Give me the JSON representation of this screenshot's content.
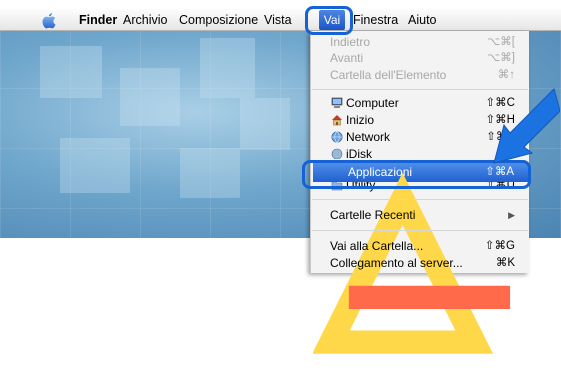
{
  "menubar": {
    "apple_icon": "apple-logo-icon",
    "items": [
      "Finder",
      "Archivio",
      "Composizione",
      "Vista",
      "Vai",
      "Finestra",
      "Aiuto"
    ]
  },
  "menu": {
    "items": [
      {
        "label": "Indietro",
        "shortcut": "⌥⌘[",
        "enabled": false
      },
      {
        "label": "Avanti",
        "shortcut": "⌥⌘]",
        "enabled": false
      },
      {
        "label": "Cartella dell'Elemento",
        "shortcut": "⌘↑",
        "enabled": false
      },
      {
        "label": "Computer",
        "shortcut": "⇧⌘C",
        "icon": "computer-icon"
      },
      {
        "label": "Inizio",
        "shortcut": "⇧⌘H",
        "icon": "home-icon"
      },
      {
        "label": "Network",
        "shortcut": "⇧⌘K",
        "icon": "network-icon"
      },
      {
        "label": "iDisk",
        "shortcut": "▶",
        "icon": "idisk-icon"
      },
      {
        "label": "Applicazioni",
        "shortcut": "⇧⌘A",
        "icon": "applications-icon",
        "selected": true
      },
      {
        "label": "Utility",
        "shortcut": "⇧⌘U",
        "icon": "utility-icon"
      },
      {
        "label": "Cartelle Recenti",
        "shortcut": "▶"
      },
      {
        "label": "Vai alla Cartella...",
        "shortcut": "⇧⌘G"
      },
      {
        "label": "Collegamento al server...",
        "shortcut": "⌘K"
      }
    ]
  },
  "colors": {
    "highlight": "#1f60d0",
    "callout": "#1462d6"
  },
  "annotation": {
    "arrow_icon": "pointer-arrow-icon"
  }
}
